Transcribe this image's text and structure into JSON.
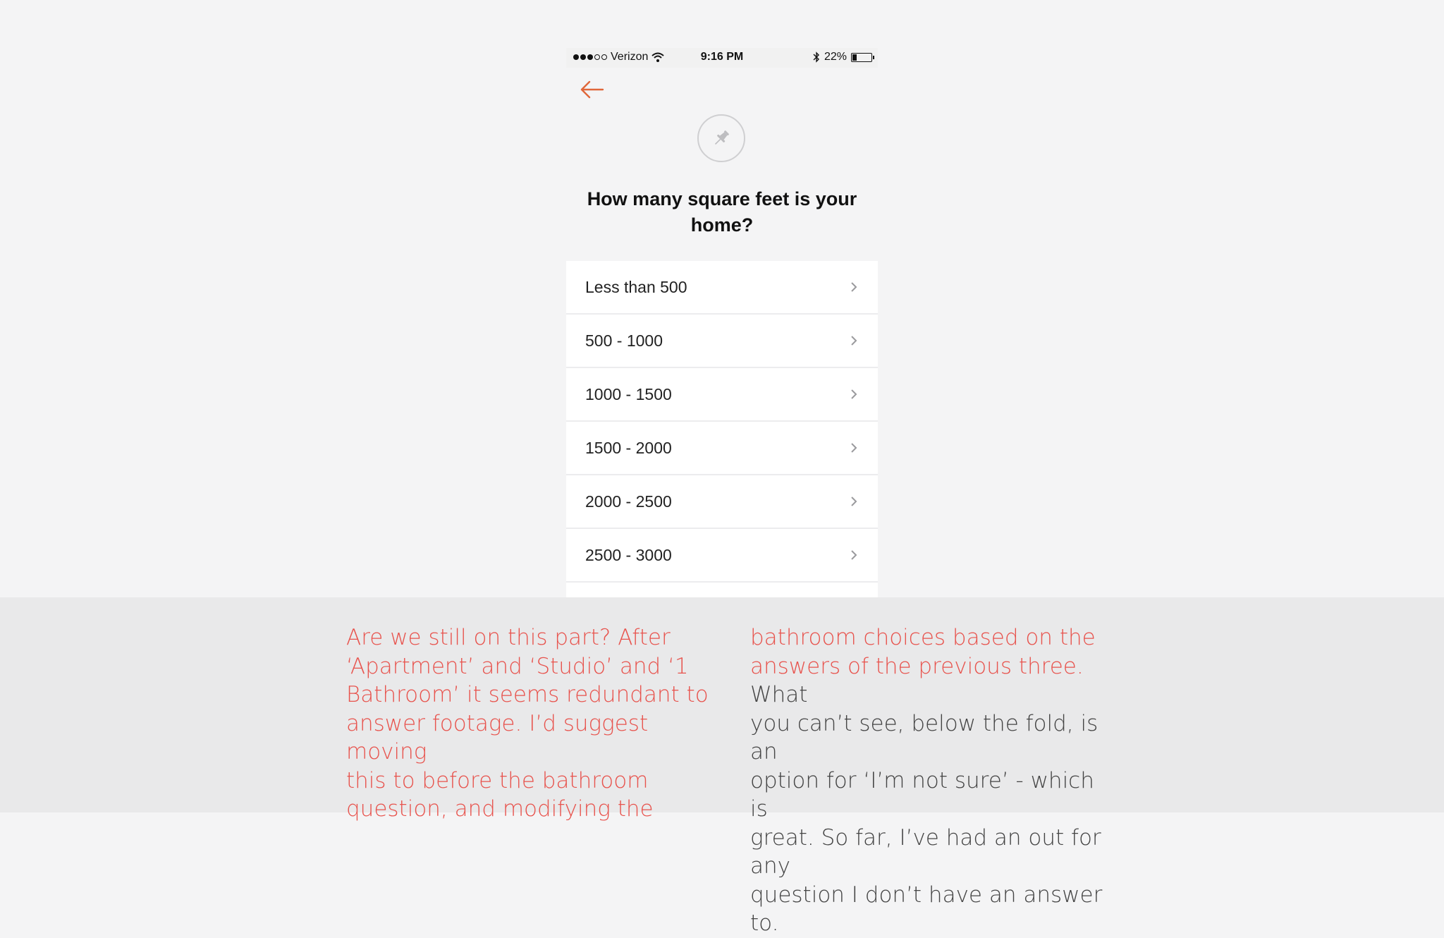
{
  "status_bar": {
    "carrier": "Verizon",
    "time": "9:16 PM",
    "battery": "22%",
    "battery_level": 0.22
  },
  "question": "How many square feet is your home?",
  "options": [
    {
      "label": "Less than 500"
    },
    {
      "label": "500 - 1000"
    },
    {
      "label": "1000 - 1500"
    },
    {
      "label": "1500 - 2000"
    },
    {
      "label": "2000 - 2500"
    },
    {
      "label": "2500 - 3000"
    }
  ],
  "caption": {
    "left": [
      "Are we still on this part? After",
      "‘Apartment’ and ‘Studio’ and ‘1",
      "Bathroom’ it seems redundant to",
      "answer footage. I’d suggest moving",
      "this to before the bathroom",
      "question, and modifying the"
    ],
    "right": [
      {
        "highlight": "bathroom choices based on the",
        "rest": ""
      },
      {
        "highlight": "answers of the previous three.",
        "rest": " What"
      },
      {
        "highlight": "",
        "rest": "you can’t see, below the fold, is an"
      },
      {
        "highlight": "",
        "rest": "option for ‘I’m not sure’ - which is"
      },
      {
        "highlight": "",
        "rest": "great. So far, I’ve had an out for any"
      },
      {
        "highlight": "",
        "rest": "question I don’t have an answer to."
      }
    ]
  },
  "colors": {
    "accent": "#e8534d",
    "back_arrow": "#e0673a"
  }
}
